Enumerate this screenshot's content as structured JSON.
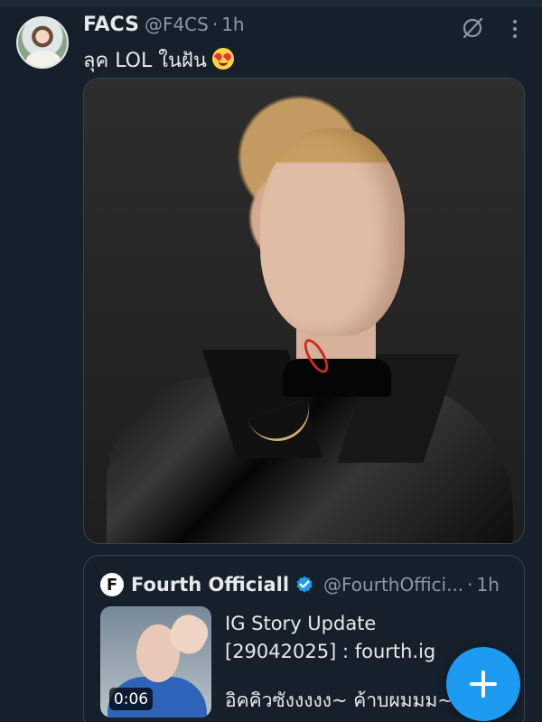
{
  "colors": {
    "background": "#15202b",
    "text": "#e7e9ea",
    "secondary_text": "#8b98a5",
    "accent": "#1d9bf0",
    "border": "#38444d"
  },
  "tweet": {
    "display_name": "FACS",
    "handle": "@F4CS",
    "separator": "·",
    "time": "1h",
    "text": "ลุค LOL ในฝัน",
    "emoji": "heart-eyes-emoji",
    "icons": {
      "grok": "grok-icon",
      "more": "more-options-icon"
    }
  },
  "quote": {
    "avatar_letter": "F",
    "display_name": "Fourth Officiall",
    "handle": "@FourthOffici...",
    "separator": "·",
    "time": "1h",
    "verified_icon": "verified-badge-icon",
    "duration": "0:06",
    "lines": [
      "IG Story Update",
      "[29042025] : fourth.ig",
      "",
      "อิคคิวซังงงงง~ ค้าบผมมม~"
    ]
  },
  "compose": {
    "icon": "plus-icon"
  }
}
